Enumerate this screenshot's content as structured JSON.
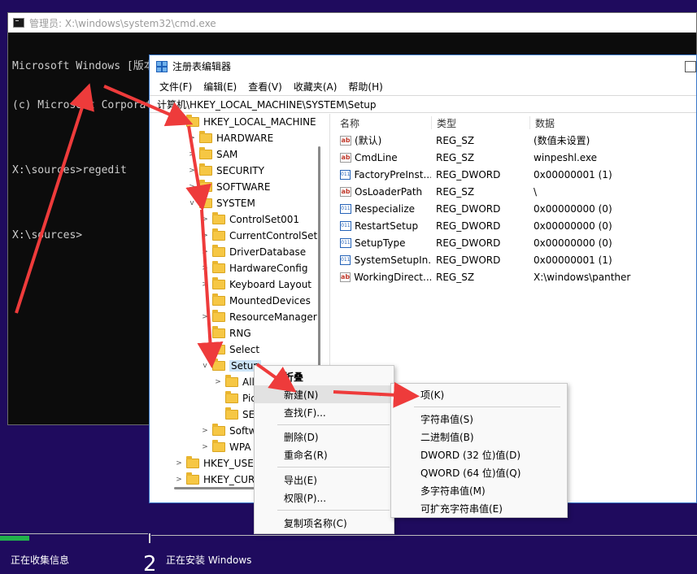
{
  "cmd": {
    "title": "管理员: X:\\windows\\system32\\cmd.exe",
    "lines": [
      "Microsoft Windows [版本 10.0.22621.819]",
      "(c) Microsoft Corporation。保留所有权利",
      "",
      "X:\\sources>regedit",
      "",
      "X:\\sources>"
    ]
  },
  "regedit": {
    "title": "注册表编辑器",
    "menu": [
      "文件(F)",
      "编辑(E)",
      "查看(V)",
      "收藏夹(A)",
      "帮助(H)"
    ],
    "address": "计算机\\HKEY_LOCAL_MACHINE\\SYSTEM\\Setup",
    "tree": [
      {
        "label": "HKEY_LOCAL_MACHINE",
        "chev": "v"
      },
      {
        "label": "HARDWARE",
        "chev": ">"
      },
      {
        "label": "SAM",
        "chev": ">"
      },
      {
        "label": "SECURITY",
        "chev": ">"
      },
      {
        "label": "SOFTWARE",
        "chev": ">"
      },
      {
        "label": "SYSTEM",
        "chev": "v"
      },
      {
        "label": "ControlSet001",
        "chev": ">"
      },
      {
        "label": "CurrentControlSet",
        "chev": ">"
      },
      {
        "label": "DriverDatabase",
        "chev": ">"
      },
      {
        "label": "HardwareConfig",
        "chev": ">"
      },
      {
        "label": "Keyboard Layout",
        "chev": ">"
      },
      {
        "label": "MountedDevices",
        "chev": ""
      },
      {
        "label": "ResourceManager",
        "chev": ">"
      },
      {
        "label": "RNG",
        "chev": ""
      },
      {
        "label": "Select",
        "chev": ""
      },
      {
        "label": "Setup",
        "chev": "v"
      },
      {
        "label": "All",
        "chev": ">"
      },
      {
        "label": "Pic",
        "chev": ""
      },
      {
        "label": "SE",
        "chev": ""
      },
      {
        "label": "Softw",
        "chev": ">"
      },
      {
        "label": "WPA",
        "chev": ">"
      },
      {
        "label": "HKEY_USER",
        "chev": ">"
      },
      {
        "label": "HKEY_CURR",
        "chev": ">"
      }
    ],
    "columns": [
      "名称",
      "类型",
      "数据"
    ],
    "values": [
      {
        "icon": "ab",
        "name": "(默认)",
        "type": "REG_SZ",
        "data": "(数值未设置)"
      },
      {
        "icon": "ab",
        "name": "CmdLine",
        "type": "REG_SZ",
        "data": "winpeshl.exe"
      },
      {
        "icon": "bin",
        "name": "FactoryPreInst...",
        "type": "REG_DWORD",
        "data": "0x00000001 (1)"
      },
      {
        "icon": "ab",
        "name": "OsLoaderPath",
        "type": "REG_SZ",
        "data": "\\"
      },
      {
        "icon": "bin",
        "name": "Respecialize",
        "type": "REG_DWORD",
        "data": "0x00000000 (0)"
      },
      {
        "icon": "bin",
        "name": "RestartSetup",
        "type": "REG_DWORD",
        "data": "0x00000000 (0)"
      },
      {
        "icon": "bin",
        "name": "SetupType",
        "type": "REG_DWORD",
        "data": "0x00000000 (0)"
      },
      {
        "icon": "bin",
        "name": "SystemSetupIn...",
        "type": "REG_DWORD",
        "data": "0x00000001 (1)"
      },
      {
        "icon": "ab",
        "name": "WorkingDirect...",
        "type": "REG_SZ",
        "data": "X:\\windows\\panther"
      }
    ]
  },
  "context_menu": {
    "collapse": "折叠",
    "new": "新建(N)",
    "find": "查找(F)...",
    "delete": "删除(D)",
    "rename": "重命名(R)",
    "export": "导出(E)",
    "permissions": "权限(P)...",
    "copy_key_name": "复制项名称(C)"
  },
  "submenu": {
    "key": "项(K)",
    "string": "字符串值(S)",
    "binary": "二进制值(B)",
    "dword": "DWORD (32 位)值(D)",
    "qword": "QWORD (64 位)值(Q)",
    "multi_string": "多字符串值(M)",
    "expandable_string": "可扩充字符串值(E)"
  },
  "installer": {
    "step1_label": "正在收集信息",
    "step2_number": "2",
    "step2_label": "正在安装 Windows",
    "progress_fraction": 0.2,
    "progress_color": "#22b24c"
  }
}
